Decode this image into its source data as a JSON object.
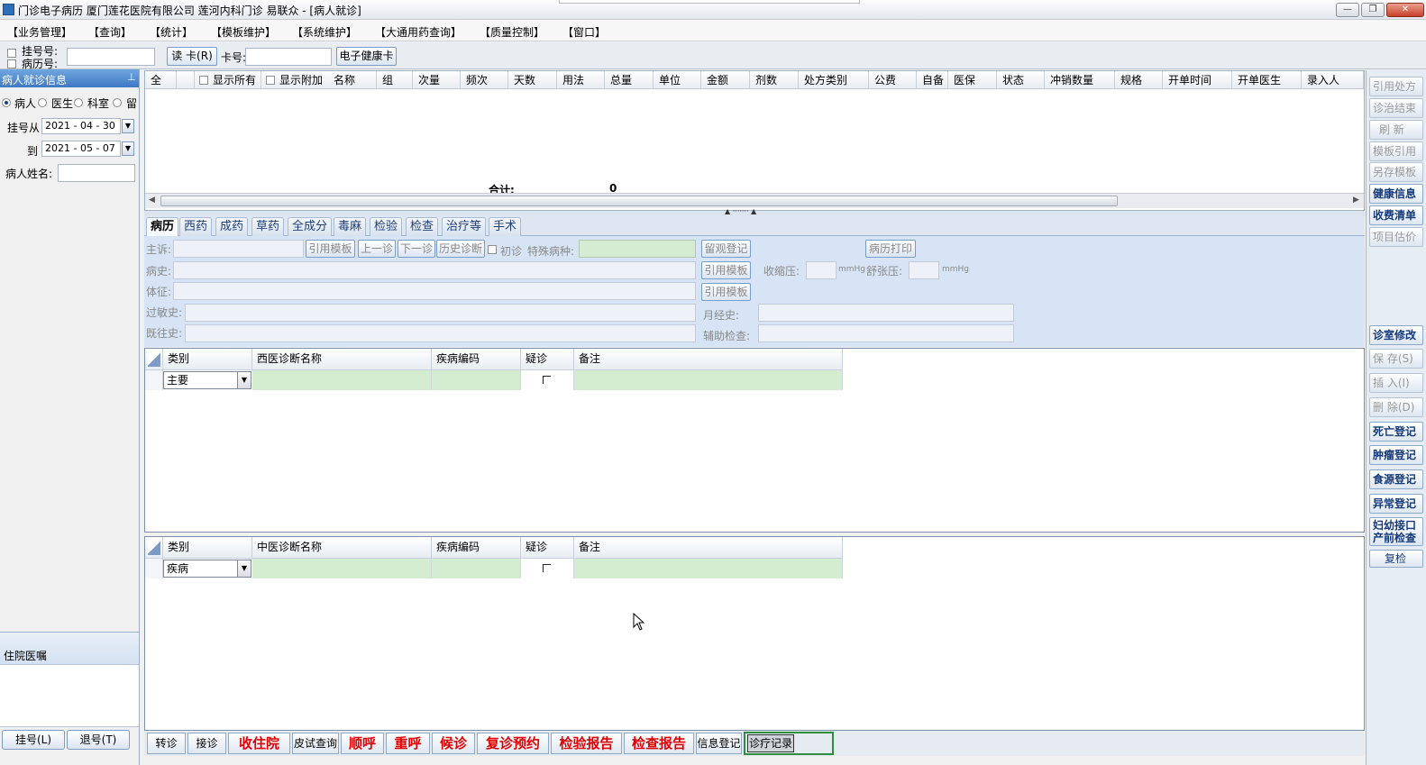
{
  "window": {
    "title": "门诊电子病历  厦门莲花医院有限公司  莲河内科门诊  易联众 - [病人就诊]",
    "controls": [
      "minimize",
      "restore",
      "close"
    ]
  },
  "menu": [
    "【业务管理】",
    "【查询】",
    "【统计】",
    "【模板维护】",
    "【系统维护】",
    "【大通用药查询】",
    "【质量控制】",
    "【窗口】"
  ],
  "toolbar": {
    "reg_no_label": "挂号号:",
    "record_no_label": "病历号:",
    "read_card_label": "读 卡(R)",
    "card_no_label": "卡号:",
    "ehealth_card_label": "电子健康卡"
  },
  "left_panel": {
    "header": "病人就诊信息",
    "pin_icon": "pin-icon",
    "radios": [
      "病人",
      "医生",
      "科室",
      "留"
    ],
    "reg_from_label": "挂号从",
    "date_from": "2021 - 04 - 30",
    "to_label": "到",
    "date_to": "2021 - 05 - 07",
    "patient_name_label": "病人姓名:",
    "inpatient_orders": "住院医嘱",
    "register_button": "挂号(L)",
    "cancel_register_button": "退号(T)"
  },
  "rx_table": {
    "headers": [
      "全",
      "",
      "显示所有",
      "显示附加",
      "名称",
      "组",
      "次量",
      "频次",
      "天数",
      "用法",
      "总量",
      "单位",
      "金额",
      "剂数",
      "处方类别",
      "公费",
      "自备",
      "医保",
      "状态",
      "冲销数量",
      "规格",
      "开单时间",
      "开单医生",
      "录入人"
    ],
    "total_label": "合计:",
    "total_value": "0"
  },
  "tabs": [
    "病历",
    "西药",
    "成药",
    "草药",
    "全成分",
    "毒麻",
    "检验",
    "检查",
    "治疗等",
    "手术"
  ],
  "record_form": {
    "chief_complaint_label": "主诉:",
    "cite_template": "引用模板",
    "prev_visit": "上一诊",
    "next_visit": "下一诊",
    "history_diag": "历史诊断",
    "first_visit": "初诊",
    "special_disease_label": "特殊病种:",
    "observation_reg": "留观登记",
    "print_record": "病历打印",
    "history_label": "病史:",
    "systolic_label": "收缩压:",
    "diastolic_label": "舒张压:",
    "mmhg": "mmHg",
    "signs_label": "体征:",
    "allergy_label": "过敏史:",
    "menstrual_label": "月经史:",
    "past_history_label": "既往史:",
    "aux_exam_label": "辅助检查:"
  },
  "western_diag": {
    "headers": [
      "类别",
      "西医诊断名称",
      "疾病编码",
      "疑诊",
      "备注"
    ],
    "row": {
      "category": "主要"
    }
  },
  "chinese_diag": {
    "headers": [
      "类别",
      "中医诊断名称",
      "疾病编码",
      "疑诊",
      "备注"
    ],
    "row": {
      "category": "疾病"
    }
  },
  "bottom_buttons": [
    {
      "label": "转诊",
      "style": "normal"
    },
    {
      "label": "接诊",
      "style": "normal"
    },
    {
      "label": "收住院",
      "style": "red"
    },
    {
      "label": "皮试查询",
      "style": "normal"
    },
    {
      "label": "顺呼",
      "style": "red"
    },
    {
      "label": "重呼",
      "style": "red"
    },
    {
      "label": "候诊",
      "style": "red"
    },
    {
      "label": "复诊预约",
      "style": "red"
    },
    {
      "label": "检验报告",
      "style": "red"
    },
    {
      "label": "检查报告",
      "style": "red"
    },
    {
      "label": "信息登记",
      "style": "normal"
    },
    {
      "label": "诊疗记录",
      "style": "selected"
    }
  ],
  "right_buttons": [
    {
      "label": "引用处方",
      "style": "dis"
    },
    {
      "label": "诊治结束",
      "style": "dis"
    },
    {
      "label": "刷 新",
      "style": "dis"
    },
    {
      "label": "模板引用",
      "style": "dis"
    },
    {
      "label": "另存模板",
      "style": "dis"
    },
    {
      "label": "健康信息",
      "style": "blue"
    },
    {
      "label": "收费清单",
      "style": "blue"
    },
    {
      "label": "项目估价",
      "style": "dis"
    },
    {
      "label": "诊室修改",
      "style": "blue"
    },
    {
      "label": "保 存(S)",
      "style": "dis"
    },
    {
      "label": "插 入(I)",
      "style": "dis"
    },
    {
      "label": "删 除(D)",
      "style": "dis"
    },
    {
      "label": "死亡登记",
      "style": "blue"
    },
    {
      "label": "肿瘤登记",
      "style": "blue"
    },
    {
      "label": "食源登记",
      "style": "blue"
    },
    {
      "label": "异常登记",
      "style": "blue"
    },
    {
      "label": "妇幼接口",
      "style": "blue"
    },
    {
      "label": "产前检查",
      "style": "blue"
    },
    {
      "label": "复检",
      "style": "normal"
    }
  ],
  "colors": {
    "accent": "#3f79c4",
    "form_bg": "#d6e4f5",
    "field_green": "#d4ecd0",
    "red_text": "#e10000"
  }
}
